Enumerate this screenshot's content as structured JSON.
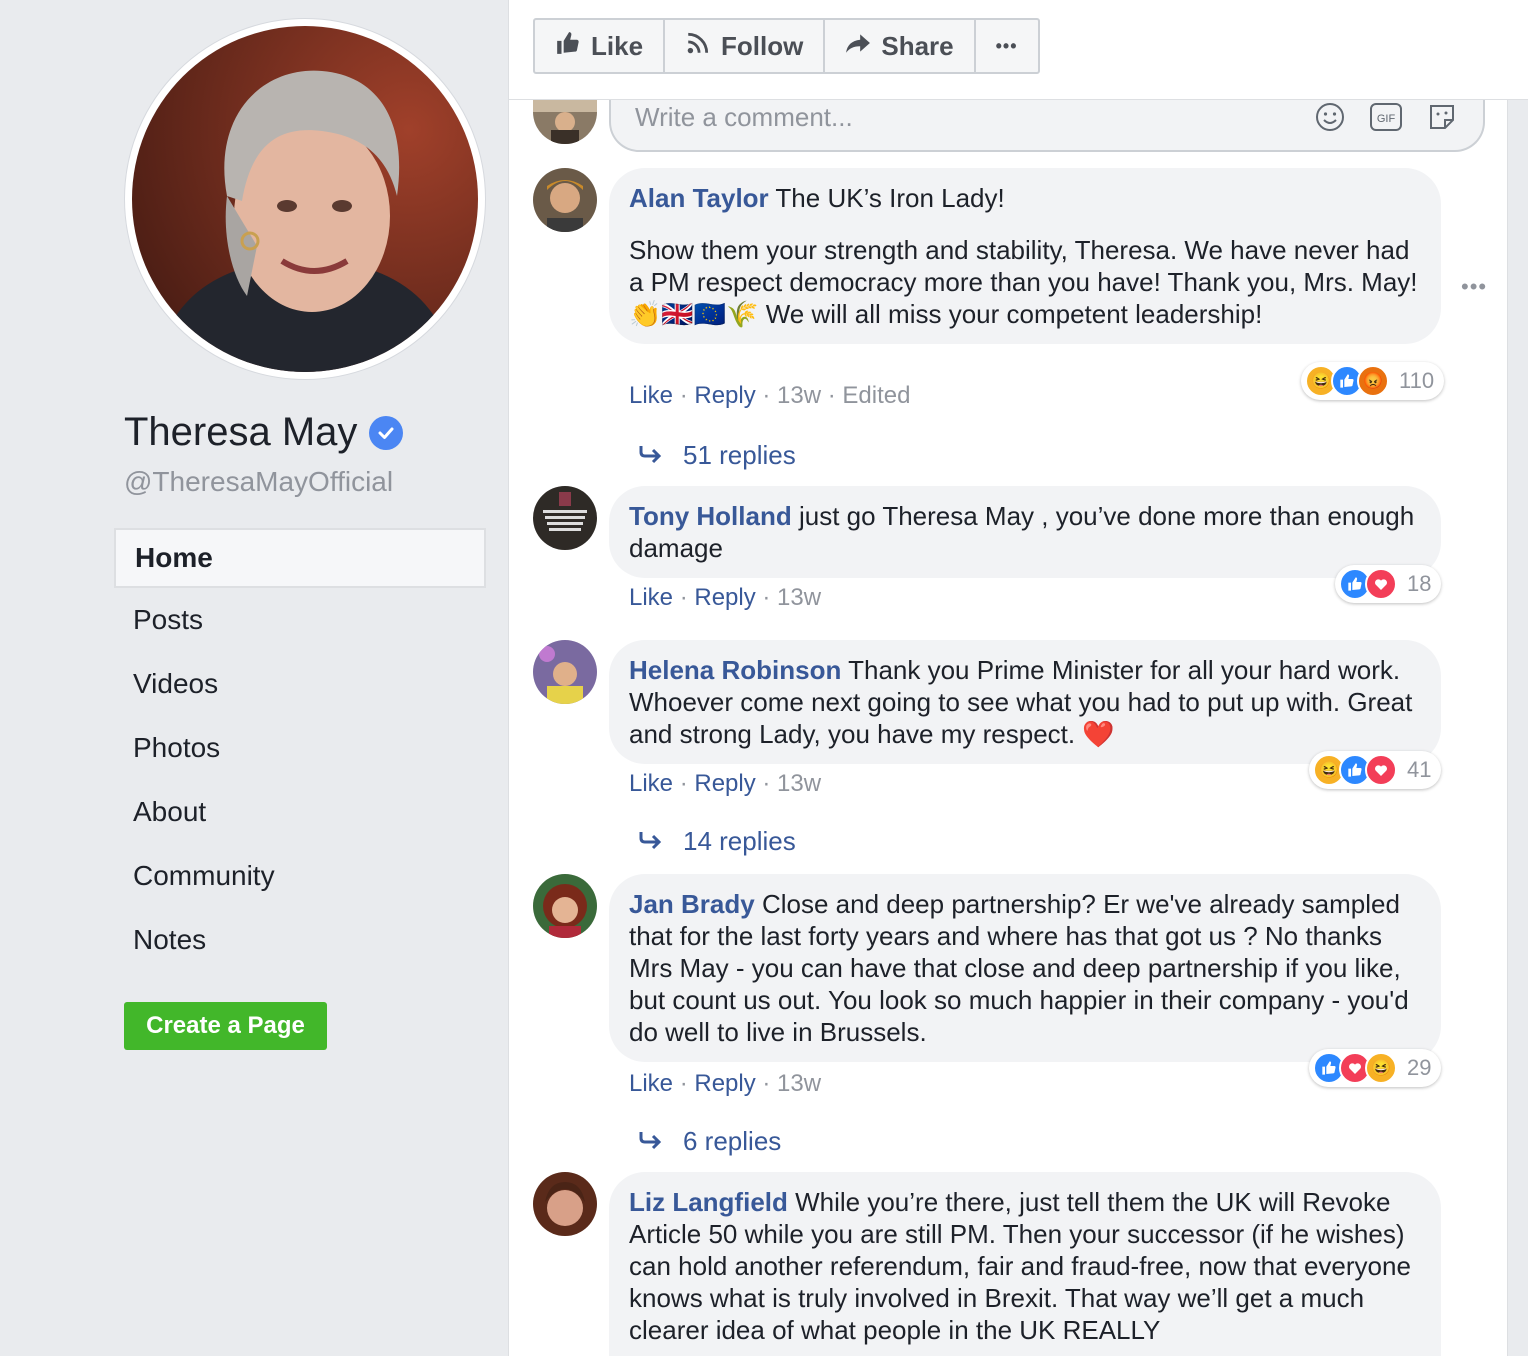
{
  "page": {
    "name": "Theresa May",
    "handle": "@TheresaMayOfficial",
    "verified_icon": "verified-check-icon"
  },
  "nav": {
    "items": [
      {
        "label": "Home",
        "active": true
      },
      {
        "label": "Posts"
      },
      {
        "label": "Videos"
      },
      {
        "label": "Photos"
      },
      {
        "label": "About"
      },
      {
        "label": "Community"
      },
      {
        "label": "Notes"
      }
    ],
    "create_label": "Create a Page"
  },
  "toolbar": {
    "like": "Like",
    "follow": "Follow",
    "share": "Share",
    "more": "•••"
  },
  "composer": {
    "placeholder": "Write a comment..."
  },
  "comments": [
    {
      "author": "Alan Taylor",
      "text_first": " The UK’s Iron Lady!",
      "text_rest": "Show them your strength and stability, Theresa. We have never had a PM respect democracy more than you have! Thank you, Mrs. May! 👏🇬🇧🇪🇺🌾 We will all miss your competent leadership!",
      "like": "Like",
      "reply": "Reply",
      "time": "13w",
      "edited": "Edited",
      "reaction_count": "110",
      "replies": "51 replies"
    },
    {
      "author": "Tony Holland",
      "text": " just go Theresa May , you’ve done more than enough damage",
      "like": "Like",
      "reply": "Reply",
      "time": "13w",
      "reaction_count": "18"
    },
    {
      "author": "Helena Robinson",
      "text": " Thank you Prime Minister for all your hard work. Whoever come next going to see what you had to put up with. Great and strong Lady, you have my respect. ❤️",
      "like": "Like",
      "reply": "Reply",
      "time": "13w",
      "reaction_count": "41",
      "replies": "14 replies"
    },
    {
      "author": "Jan Brady",
      "text": " Close and deep partnership? Er we've already sampled that for the last forty years and where has that got us ? No thanks Mrs May - you can have that close and deep partnership if you like, but count us out. You look so much happier in their company - you'd do well to live in Brussels.",
      "like": "Like",
      "reply": "Reply",
      "time": "13w",
      "reaction_count": "29",
      "replies": "6 replies"
    },
    {
      "author": "Liz Langfield",
      "text": " While you’re there, just tell them the UK will Revoke Article 50 while you are still PM. Then your successor (if he wishes) can hold another referendum, fair and fraud-free, now that everyone knows what is truly involved in Brexit. That way we’ll get a much clearer idea of what people in the UK REALLY"
    }
  ],
  "colors": {
    "link": "#385898",
    "create_button": "#42b72a",
    "verified": "#4b86f3"
  }
}
